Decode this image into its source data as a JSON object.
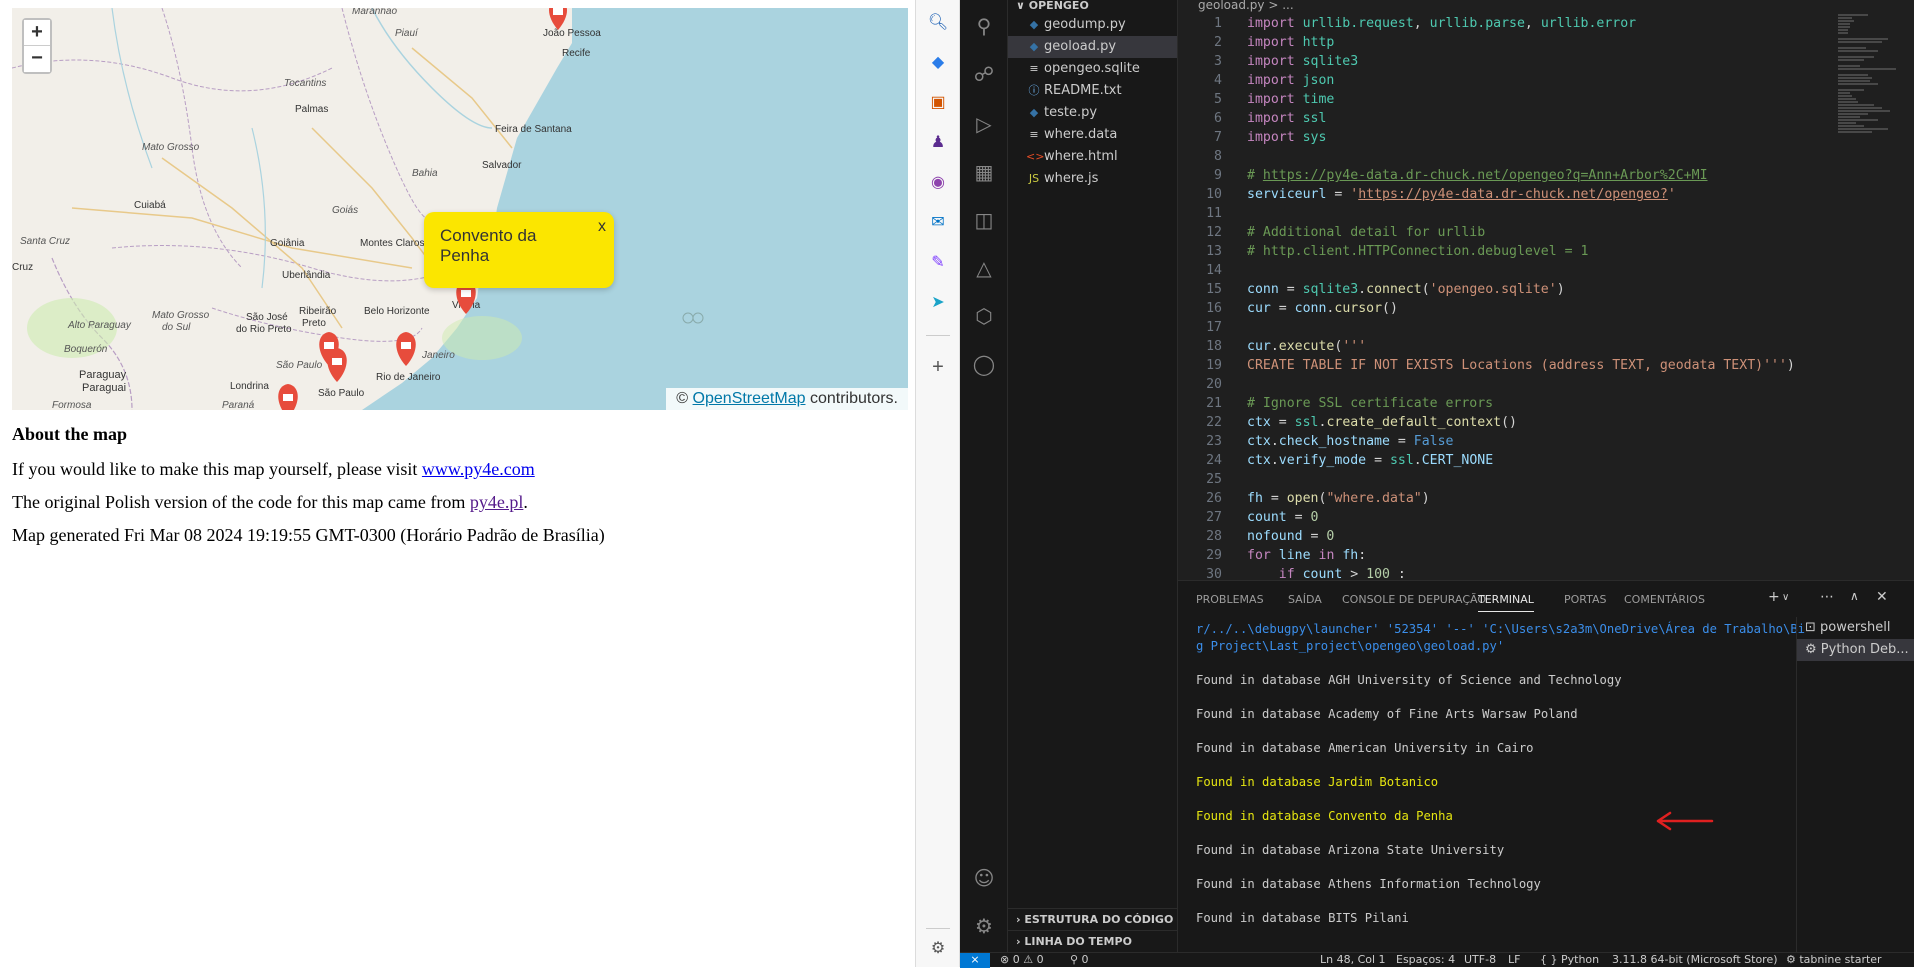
{
  "map": {
    "zoom_in": "+",
    "zoom_out": "−",
    "popup_text": "Convento da Penha",
    "popup_close": "x",
    "attribution_prefix": "©",
    "attribution_link": "OpenStreetMap",
    "attribution_suffix": "contributors.",
    "labels": {
      "joao_pessoa": "João Pessoa",
      "recife": "Recife",
      "piaui": "Piauí",
      "tocantins": "Tocantins",
      "palmas": "Palmas",
      "feira": "Feira de Santana",
      "mato_grosso": "Mato Grosso",
      "bahia": "Bahia",
      "salvador": "Salvador",
      "cuiaba": "Cuiabá",
      "goias": "Goiás",
      "goiania": "Goiânia",
      "montes_claros": "Montes Claros",
      "santa_cruz": "Santa Cruz",
      "cruz": "Cruz",
      "uberlandia": "Uberlândia",
      "ribeirao": "Ribeirão",
      "preto": "Preto",
      "mato_grosso_sul_1": "Mato Grosso",
      "mato_grosso_sul_2": "do Sul",
      "sao_jose_1": "São José",
      "sao_jose_2": "do Rio Preto",
      "belo_horizonte": "Belo Horizonte",
      "vitoria": "Vitória",
      "alto_paraguay": "Alto Paraguay",
      "boqueron": "Boquerón",
      "paraguay": "Paraguay",
      "paraguai": "Paraguai",
      "sao_paulo_state": "São Paulo",
      "sao_paulo": "São Paulo",
      "rio_de_janeiro": "Rio de Janeiro",
      "janeiro": "Janeiro",
      "londrina": "Londrina",
      "parana": "Paraná",
      "formosa": "Formosa",
      "maranhao": "Maranhão"
    }
  },
  "content": {
    "heading": "About the map",
    "p1_text": "If you would like to make this map yourself, please visit",
    "p1_link": "www.py4e.com",
    "p2_text": "The original Polish version of the code for this map came from",
    "p2_link": "py4e.pl",
    "p2_end": ".",
    "p3": "Map generated Fri Mar 08 2024 19:19:55 GMT-0300 (Horário Padrão de Brasília)"
  },
  "explorer": {
    "folder": "OPENGEO",
    "files": [
      {
        "name": "geodump.py",
        "icon": "py"
      },
      {
        "name": "geoload.py",
        "icon": "py"
      },
      {
        "name": "opengeo.sqlite",
        "icon": "db"
      },
      {
        "name": "README.txt",
        "icon": "info"
      },
      {
        "name": "teste.py",
        "icon": "py"
      },
      {
        "name": "where.data",
        "icon": "txt"
      },
      {
        "name": "where.html",
        "icon": "html"
      },
      {
        "name": "where.js",
        "icon": "js"
      }
    ],
    "outline": "ESTRUTURA DO CÓDIGO",
    "timeline": "LINHA DO TEMPO"
  },
  "editor": {
    "breadcrumb": "geoload.py  >  ...",
    "lines": [
      [
        {
          "c": "kw",
          "t": "import"
        },
        {
          "c": "pl",
          "t": " "
        },
        {
          "c": "mod",
          "t": "urllib.request"
        },
        {
          "c": "pl",
          "t": ", "
        },
        {
          "c": "mod",
          "t": "urllib.parse"
        },
        {
          "c": "pl",
          "t": ", "
        },
        {
          "c": "mod",
          "t": "urllib.error"
        }
      ],
      [
        {
          "c": "kw",
          "t": "import"
        },
        {
          "c": "pl",
          "t": " "
        },
        {
          "c": "mod",
          "t": "http"
        }
      ],
      [
        {
          "c": "kw",
          "t": "import"
        },
        {
          "c": "pl",
          "t": " "
        },
        {
          "c": "mod",
          "t": "sqlite3"
        }
      ],
      [
        {
          "c": "kw",
          "t": "import"
        },
        {
          "c": "pl",
          "t": " "
        },
        {
          "c": "mod",
          "t": "json"
        }
      ],
      [
        {
          "c": "kw",
          "t": "import"
        },
        {
          "c": "pl",
          "t": " "
        },
        {
          "c": "mod",
          "t": "time"
        }
      ],
      [
        {
          "c": "kw",
          "t": "import"
        },
        {
          "c": "pl",
          "t": " "
        },
        {
          "c": "mod",
          "t": "ssl"
        }
      ],
      [
        {
          "c": "kw",
          "t": "import"
        },
        {
          "c": "pl",
          "t": " "
        },
        {
          "c": "mod",
          "t": "sys"
        }
      ],
      [],
      [
        {
          "c": "com",
          "t": "# "
        },
        {
          "c": "com url",
          "t": "https://py4e-data.dr-chuck.net/opengeo?q=Ann+Arbor%2C+MI"
        }
      ],
      [
        {
          "c": "var",
          "t": "serviceurl"
        },
        {
          "c": "pl",
          "t": " = "
        },
        {
          "c": "str",
          "t": "'"
        },
        {
          "c": "str url",
          "t": "https://py4e-data.dr-chuck.net/opengeo?"
        },
        {
          "c": "str",
          "t": "'"
        }
      ],
      [],
      [
        {
          "c": "com",
          "t": "# Additional detail for urllib"
        }
      ],
      [
        {
          "c": "com",
          "t": "# http.client.HTTPConnection.debuglevel = 1"
        }
      ],
      [],
      [
        {
          "c": "var",
          "t": "conn"
        },
        {
          "c": "pl",
          "t": " = "
        },
        {
          "c": "mod",
          "t": "sqlite3"
        },
        {
          "c": "pl",
          "t": "."
        },
        {
          "c": "fn",
          "t": "connect"
        },
        {
          "c": "pl",
          "t": "("
        },
        {
          "c": "str",
          "t": "'opengeo.sqlite'"
        },
        {
          "c": "pl",
          "t": ")"
        }
      ],
      [
        {
          "c": "var",
          "t": "cur"
        },
        {
          "c": "pl",
          "t": " = "
        },
        {
          "c": "var",
          "t": "conn"
        },
        {
          "c": "pl",
          "t": "."
        },
        {
          "c": "fn",
          "t": "cursor"
        },
        {
          "c": "pl",
          "t": "()"
        }
      ],
      [],
      [
        {
          "c": "var",
          "t": "cur"
        },
        {
          "c": "pl",
          "t": "."
        },
        {
          "c": "fn",
          "t": "execute"
        },
        {
          "c": "pl",
          "t": "("
        },
        {
          "c": "str",
          "t": "'''"
        }
      ],
      [
        {
          "c": "str",
          "t": "CREATE TABLE IF NOT EXISTS Locations (address TEXT, geodata TEXT)'''"
        },
        {
          "c": "pl",
          "t": ")"
        }
      ],
      [],
      [
        {
          "c": "com",
          "t": "# Ignore SSL certificate errors"
        }
      ],
      [
        {
          "c": "var",
          "t": "ctx"
        },
        {
          "c": "pl",
          "t": " = "
        },
        {
          "c": "mod",
          "t": "ssl"
        },
        {
          "c": "pl",
          "t": "."
        },
        {
          "c": "fn",
          "t": "create_default_context"
        },
        {
          "c": "pl",
          "t": "()"
        }
      ],
      [
        {
          "c": "var",
          "t": "ctx"
        },
        {
          "c": "pl",
          "t": "."
        },
        {
          "c": "var",
          "t": "check_hostname"
        },
        {
          "c": "pl",
          "t": " = "
        },
        {
          "c": "kwb",
          "t": "False"
        }
      ],
      [
        {
          "c": "var",
          "t": "ctx"
        },
        {
          "c": "pl",
          "t": "."
        },
        {
          "c": "var",
          "t": "verify_mode"
        },
        {
          "c": "pl",
          "t": " = "
        },
        {
          "c": "mod",
          "t": "ssl"
        },
        {
          "c": "pl",
          "t": "."
        },
        {
          "c": "var",
          "t": "CERT_NONE"
        }
      ],
      [],
      [
        {
          "c": "var",
          "t": "fh"
        },
        {
          "c": "pl",
          "t": " = "
        },
        {
          "c": "fn",
          "t": "open"
        },
        {
          "c": "pl",
          "t": "("
        },
        {
          "c": "str",
          "t": "\"where.data\""
        },
        {
          "c": "pl",
          "t": ")"
        }
      ],
      [
        {
          "c": "var",
          "t": "count"
        },
        {
          "c": "pl",
          "t": " = "
        },
        {
          "c": "num",
          "t": "0"
        }
      ],
      [
        {
          "c": "var",
          "t": "nofound"
        },
        {
          "c": "pl",
          "t": " = "
        },
        {
          "c": "num",
          "t": "0"
        }
      ],
      [
        {
          "c": "kw",
          "t": "for"
        },
        {
          "c": "pl",
          "t": " "
        },
        {
          "c": "var",
          "t": "line"
        },
        {
          "c": "pl",
          "t": " "
        },
        {
          "c": "kw",
          "t": "in"
        },
        {
          "c": "pl",
          "t": " "
        },
        {
          "c": "var",
          "t": "fh"
        },
        {
          "c": "pl",
          "t": ":"
        }
      ],
      [
        {
          "c": "pl",
          "t": "    "
        },
        {
          "c": "kw",
          "t": "if"
        },
        {
          "c": "pl",
          "t": " "
        },
        {
          "c": "var",
          "t": "count"
        },
        {
          "c": "pl",
          "t": " > "
        },
        {
          "c": "num",
          "t": "100"
        },
        {
          "c": "pl",
          "t": " :"
        }
      ]
    ]
  },
  "panel": {
    "tabs": [
      "PROBLEMAS",
      "SAÍDA",
      "CONSOLE DE DEPURAÇÃO",
      "TERMINAL",
      "PORTAS",
      "COMENTÁRIOS"
    ],
    "active_tab": "TERMINAL",
    "terminal_lines": [
      {
        "t": "r/../..\\debugpy\\launcher' '52354' '--' 'C:\\Users\\s2a3m\\OneDrive\\Área de Trabalho\\Bi",
        "k": "path"
      },
      {
        "t": "g Project\\Last_project\\opengeo\\geoload.py'",
        "k": "path"
      },
      {
        "t": "",
        "k": ""
      },
      {
        "t": "Found in database AGH University of Science and Technology",
        "k": ""
      },
      {
        "t": "",
        "k": ""
      },
      {
        "t": "Found in database Academy of Fine Arts Warsaw Poland",
        "k": ""
      },
      {
        "t": "",
        "k": ""
      },
      {
        "t": "Found in database American University in Cairo",
        "k": ""
      },
      {
        "t": "",
        "k": ""
      },
      {
        "t": "Found in database Jardim Botanico",
        "k": "hl"
      },
      {
        "t": "",
        "k": ""
      },
      {
        "t": "Found in database Convento da Penha",
        "k": "hl"
      },
      {
        "t": "",
        "k": ""
      },
      {
        "t": "Found in database Arizona State University",
        "k": ""
      },
      {
        "t": "",
        "k": ""
      },
      {
        "t": "Found in database Athens Information Technology",
        "k": ""
      },
      {
        "t": "",
        "k": ""
      },
      {
        "t": "Found in database BITS Pilani",
        "k": ""
      }
    ],
    "terminals": [
      "powershell",
      "Python Deb..."
    ]
  },
  "statusbar": {
    "errors": "⊗ 0 ⚠ 0",
    "ports": "⚲ 0",
    "position": "Ln 48, Col 1",
    "spaces": "Espaços: 4",
    "encoding": "UTF-8",
    "eol": "LF",
    "language": "{ } Python",
    "interpreter": "3.11.8 64-bit (Microsoft Store)",
    "tabnine": "⚙ tabnine starter"
  },
  "colors": {
    "popup": "#fbe600",
    "marker": "#e74c3c",
    "water": "#aad3df",
    "vscode_bg": "#1f1f1f",
    "terminal_highlight": "#e5e510"
  }
}
